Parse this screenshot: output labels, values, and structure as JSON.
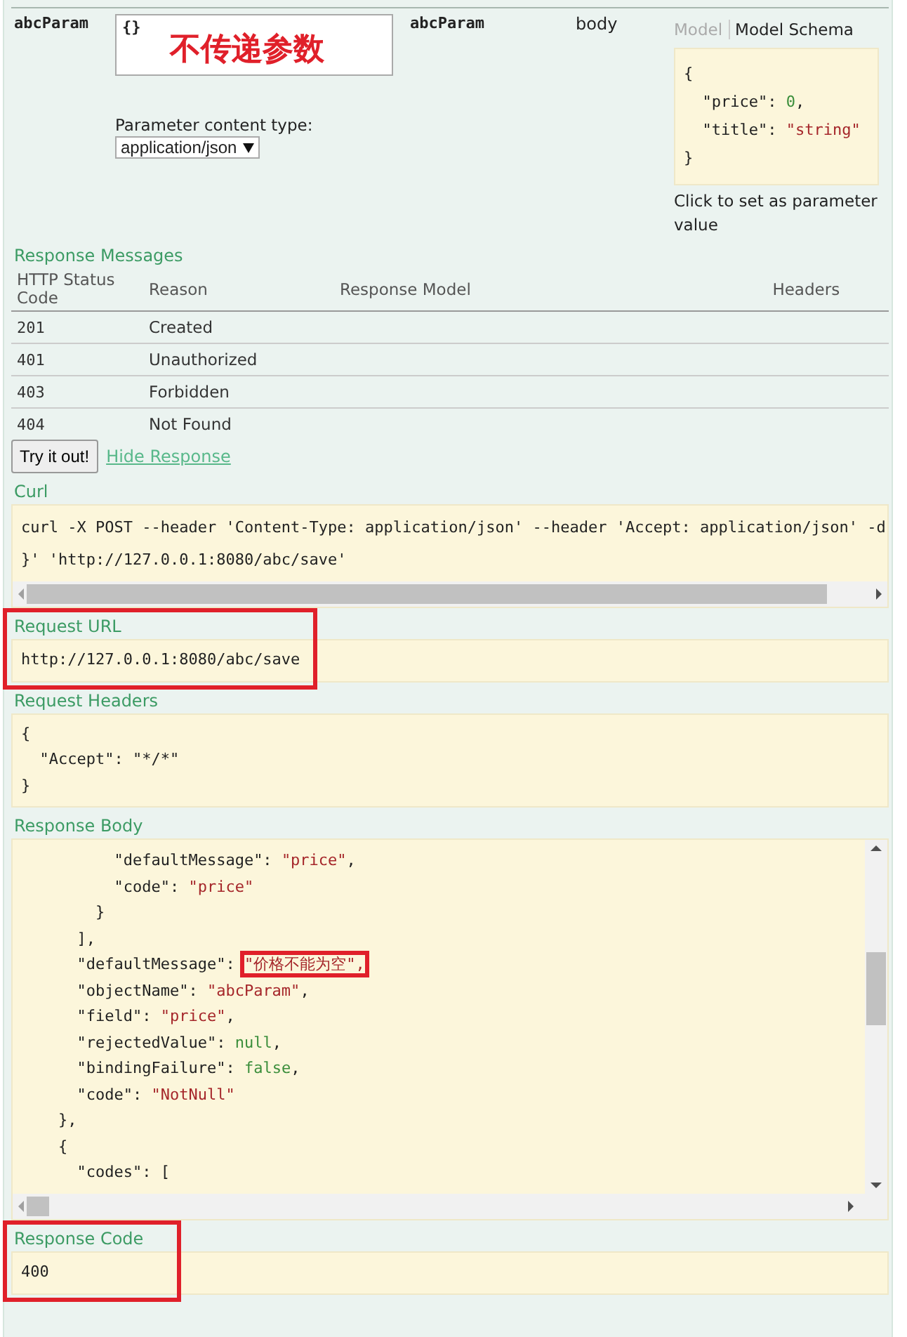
{
  "parameter": {
    "name": "abcParam",
    "value": "{}",
    "annotation": "不传递参数",
    "content_type_label": "Parameter content type:",
    "content_type": "application/json",
    "param_name": "abcParam",
    "param_type": "body",
    "model_tabs": [
      {
        "label": "Model",
        "selected": false
      },
      {
        "label": "Model Schema",
        "selected": true
      }
    ],
    "schema_lines": [
      [
        {
          "t": "{",
          "kind": "punct"
        }
      ],
      [
        {
          "t": "  \"price\": ",
          "kind": "key"
        },
        {
          "t": "0",
          "kind": "lit"
        },
        {
          "t": ",",
          "kind": "punct"
        }
      ],
      [
        {
          "t": "  \"title\": ",
          "kind": "key"
        },
        {
          "t": "\"string\"",
          "kind": "str"
        }
      ],
      [
        {
          "t": "}",
          "kind": "punct"
        }
      ]
    ],
    "schema_hint": "Click to set as parameter value"
  },
  "response_messages": {
    "title": "Response Messages",
    "columns": [
      "HTTP Status Code",
      "Reason",
      "Response Model",
      "Headers"
    ],
    "rows": [
      [
        "201",
        "Created"
      ],
      [
        "401",
        "Unauthorized"
      ],
      [
        "403",
        "Forbidden"
      ],
      [
        "404",
        "Not Found"
      ]
    ]
  },
  "try_button": "Try it out!",
  "hide_link": "Hide Response",
  "sections": [
    {
      "kind": "scroll",
      "title": "Curl",
      "highlighted": false,
      "lines": [
        [
          {
            "t": "curl -X POST --header 'Content-Type: application/json' --header 'Accept: application/json' -d",
            "kind": "punct"
          }
        ],
        [
          {
            "t": "}' 'http://127.0.0.1:8080/abc/save'",
            "kind": "punct"
          }
        ]
      ]
    },
    {
      "kind": "plain",
      "title": "Request URL",
      "highlighted": true,
      "lines": [
        [
          {
            "t": "http://127.0.0.1:8080/abc/save",
            "kind": "punct"
          }
        ]
      ]
    },
    {
      "kind": "plain",
      "title": "Request Headers",
      "highlighted": false,
      "lines": [
        [
          {
            "t": "{",
            "kind": "punct"
          }
        ],
        [
          {
            "t": "  \"Accept\": \"*/*\"",
            "kind": "punct"
          }
        ],
        [
          {
            "t": "}",
            "kind": "punct"
          }
        ]
      ]
    },
    {
      "kind": "body",
      "title": "Response Body",
      "highlighted": false,
      "lines": [
        [
          {
            "t": "          \"defaultMessage\": ",
            "kind": "key"
          },
          {
            "t": "\"price\"",
            "kind": "str"
          },
          {
            "t": ",",
            "kind": "punct"
          }
        ],
        [
          {
            "t": "          \"code\": ",
            "kind": "key"
          },
          {
            "t": "\"price\"",
            "kind": "str"
          }
        ],
        [
          {
            "t": "        }",
            "kind": "punct"
          }
        ],
        [
          {
            "t": "      ],",
            "kind": "punct"
          }
        ],
        [
          {
            "t": "      \"defaultMessage\": ",
            "kind": "key"
          },
          {
            "t": "\"价格不能为空\",",
            "kind": "str",
            "highlighted": true
          }
        ],
        [
          {
            "t": "      \"objectName\": ",
            "kind": "key"
          },
          {
            "t": "\"abcParam\"",
            "kind": "str"
          },
          {
            "t": ",",
            "kind": "punct"
          }
        ],
        [
          {
            "t": "      \"field\": ",
            "kind": "key"
          },
          {
            "t": "\"price\"",
            "kind": "str"
          },
          {
            "t": ",",
            "kind": "punct"
          }
        ],
        [
          {
            "t": "      \"rejectedValue\": ",
            "kind": "key"
          },
          {
            "t": "null",
            "kind": "lit"
          },
          {
            "t": ",",
            "kind": "punct"
          }
        ],
        [
          {
            "t": "      \"bindingFailure\": ",
            "kind": "key"
          },
          {
            "t": "false",
            "kind": "lit"
          },
          {
            "t": ",",
            "kind": "punct"
          }
        ],
        [
          {
            "t": "      \"code\": ",
            "kind": "key"
          },
          {
            "t": "\"NotNull\"",
            "kind": "str"
          }
        ],
        [
          {
            "t": "    },",
            "kind": "punct"
          }
        ],
        [
          {
            "t": "    {",
            "kind": "punct"
          }
        ],
        [
          {
            "t": "      \"codes\": [",
            "kind": "key"
          }
        ]
      ]
    },
    {
      "kind": "plain",
      "title": "Response Code",
      "highlighted": true,
      "lines": [
        [
          {
            "t": "400",
            "kind": "punct"
          }
        ]
      ]
    }
  ]
}
